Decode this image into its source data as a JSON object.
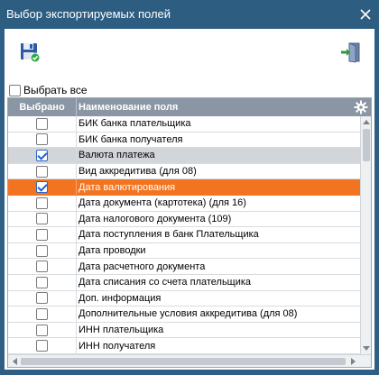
{
  "window": {
    "title": "Выбор экспортируемых полей",
    "close_icon": "close-icon"
  },
  "toolbar": {
    "save_icon": "save-check-icon",
    "exit_icon": "exit-door-icon"
  },
  "select_all": {
    "label": "Выбрать все",
    "checked": false
  },
  "grid": {
    "columns": [
      "Выбрано",
      "Наименование поля"
    ],
    "settings_icon": "gear-icon",
    "rows": [
      {
        "name": "БИК банка плательщика",
        "checked": false,
        "state": "normal"
      },
      {
        "name": "БИК банка получателя",
        "checked": false,
        "state": "normal"
      },
      {
        "name": "Валюта платежа",
        "checked": true,
        "state": "selected"
      },
      {
        "name": "Вид аккредитива (для 08)",
        "checked": false,
        "state": "normal"
      },
      {
        "name": "Дата валютирования",
        "checked": true,
        "state": "active"
      },
      {
        "name": "Дата документа (картотека) (для 16)",
        "checked": false,
        "state": "normal"
      },
      {
        "name": "Дата налогового документа (109)",
        "checked": false,
        "state": "normal"
      },
      {
        "name": "Дата поступления в банк Плательщика",
        "checked": false,
        "state": "normal"
      },
      {
        "name": "Дата проводки",
        "checked": false,
        "state": "normal"
      },
      {
        "name": "Дата расчетного документа",
        "checked": false,
        "state": "normal"
      },
      {
        "name": "Дата списания со счета плательщика",
        "checked": false,
        "state": "normal"
      },
      {
        "name": "Доп. информация",
        "checked": false,
        "state": "normal"
      },
      {
        "name": "Дополнительные условия аккредитива (для 08)",
        "checked": false,
        "state": "normal"
      },
      {
        "name": "ИНН плательщика",
        "checked": false,
        "state": "normal"
      },
      {
        "name": "ИНН получателя",
        "checked": false,
        "state": "normal"
      }
    ]
  },
  "colors": {
    "titlebar": "#2e5d82",
    "header": "#8a96a3",
    "active_row": "#f27421",
    "selected_row": "#d2d6da"
  }
}
